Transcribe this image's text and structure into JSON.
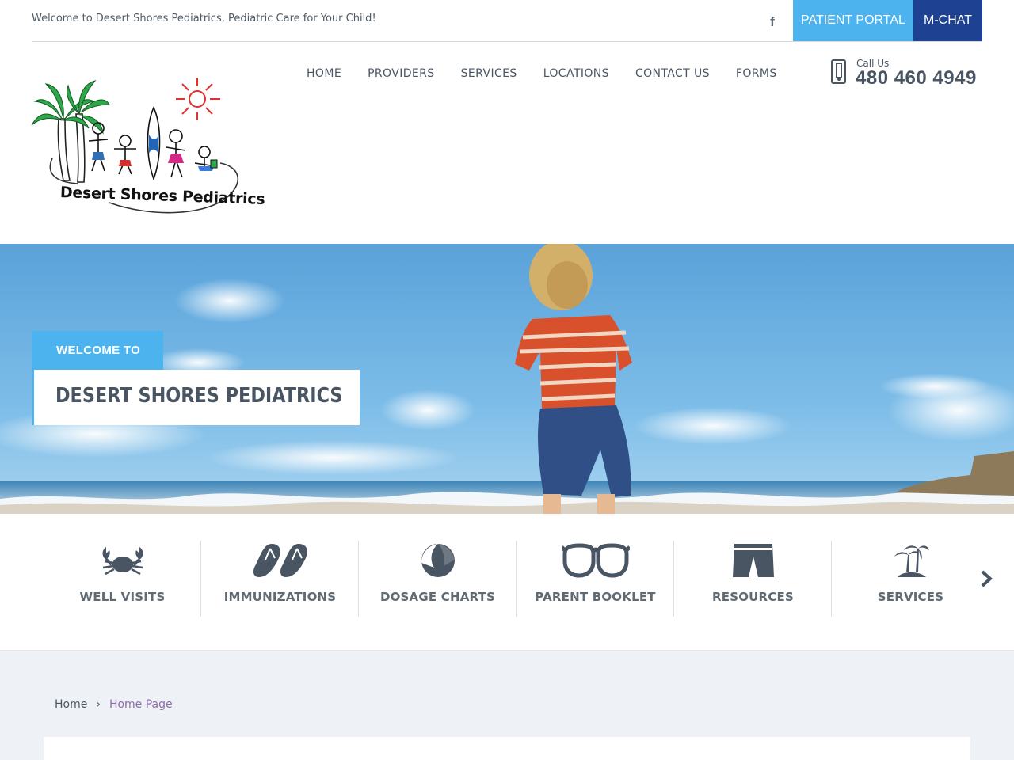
{
  "topbar": {
    "welcome_text": "Welcome to Desert Shores Pediatrics, Pediatric Care for Your Child!",
    "social_icon": "facebook-icon",
    "patient_portal_label": "PATIENT PORTAL",
    "mchat_label": "M-CHAT"
  },
  "header": {
    "logo_text": "Desert Shores Pediatrics",
    "nav": [
      "HOME",
      "PROVIDERS",
      "SERVICES",
      "LOCATIONS",
      "CONTACT US",
      "FORMS"
    ],
    "call_label": "Call Us",
    "phone_number": "480 460 4949"
  },
  "hero": {
    "welcome_tag": "WELCOME TO",
    "title": "DESERT SHORES PEDIATRICS"
  },
  "services": {
    "items": [
      {
        "label": "WELL VISITS",
        "icon": "crab-icon"
      },
      {
        "label": "IMMUNIZATIONS",
        "icon": "flip-flops-icon"
      },
      {
        "label": "DOSAGE CHARTS",
        "icon": "beach-ball-icon"
      },
      {
        "label": "PARENT BOOKLET",
        "icon": "sunglasses-icon"
      },
      {
        "label": "RESOURCES",
        "icon": "swim-shorts-icon"
      },
      {
        "label": "SERVICES",
        "icon": "palm-island-icon"
      }
    ],
    "next_icon": "chevron-right-icon"
  },
  "breadcrumb": {
    "home": "Home",
    "separator": "›",
    "current": "Home Page"
  },
  "colors": {
    "accent_light_blue": "#4db3ee",
    "accent_dark_blue": "#1e4291",
    "text_gray": "#4a5563",
    "breadcrumb_current": "#8d6da8",
    "lower_background": "#eef2f6"
  }
}
